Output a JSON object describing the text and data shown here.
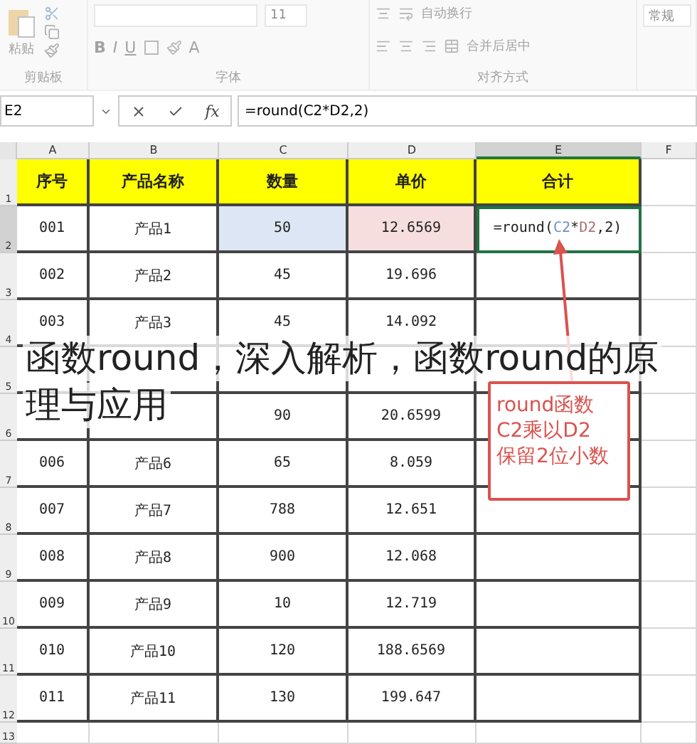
{
  "ribbon": {
    "disabled": true,
    "groups": [
      {
        "kind": "clipboard",
        "label": "剪贴板",
        "paste": "粘贴"
      },
      {
        "kind": "font",
        "label": "字体",
        "size": "11",
        "bold": "B",
        "italic": "I",
        "underline": "U",
        "font_color": "A"
      },
      {
        "kind": "alignment",
        "label": "对齐方式",
        "wrap": "自动换行",
        "merge": "合并后居中"
      },
      {
        "kind": "number",
        "format": "常规"
      }
    ]
  },
  "formula_bar": {
    "name_box": "E2",
    "function": "fx",
    "formula": "=round(C2*D2,2)"
  },
  "columns": [
    {
      "label": "A",
      "selected": false
    },
    {
      "label": "B",
      "selected": false
    },
    {
      "label": "C",
      "selected": false
    },
    {
      "label": "D",
      "selected": false
    },
    {
      "label": "E",
      "selected": true
    },
    {
      "label": "F",
      "selected": false
    }
  ],
  "rows": [
    {
      "label": "1",
      "selected": false,
      "kind": "header",
      "cells": [
        {
          "text": "序号"
        },
        {
          "text": "产品名称"
        },
        {
          "text": "数量"
        },
        {
          "text": "单价"
        },
        {
          "text": "合计"
        }
      ]
    },
    {
      "label": "2",
      "selected": true,
      "kind": "data",
      "cells": [
        {
          "text": "001"
        },
        {
          "text": "产品1"
        },
        {
          "text": "50",
          "color": "#dce6f4"
        },
        {
          "text": "12.6569",
          "color": "#f7dede"
        },
        {
          "active": true,
          "parts": [
            {
              "text": "=round("
            },
            {
              "text": "C2",
              "color": "#6f8fc8"
            },
            {
              "text": "*"
            },
            {
              "text": "D2",
              "color": "#b07070"
            },
            {
              "text": ",2)"
            }
          ]
        }
      ]
    },
    {
      "label": "3",
      "selected": false,
      "kind": "data",
      "cells": [
        {
          "text": "002"
        },
        {
          "text": "产品2"
        },
        {
          "text": "45"
        },
        {
          "text": "19.696"
        },
        {}
      ]
    },
    {
      "label": "4",
      "selected": false,
      "kind": "data",
      "cells": [
        {
          "text": "003"
        },
        {
          "text": "产品3"
        },
        {
          "text": "45"
        },
        {
          "text": "14.092"
        },
        {}
      ]
    },
    {
      "label": "5",
      "selected": false,
      "kind": "data",
      "cells": [
        {},
        {},
        {},
        {},
        {}
      ]
    },
    {
      "label": "6",
      "selected": false,
      "kind": "data",
      "cells": [
        {},
        {},
        {
          "text": "90"
        },
        {
          "text": "20.6599"
        },
        {}
      ]
    },
    {
      "label": "7",
      "selected": false,
      "kind": "data",
      "cells": [
        {
          "text": "006"
        },
        {
          "text": "产品6"
        },
        {
          "text": "65"
        },
        {
          "text": "8.059"
        },
        {}
      ]
    },
    {
      "label": "8",
      "selected": false,
      "kind": "data",
      "cells": [
        {
          "text": "007"
        },
        {
          "text": "产品7"
        },
        {
          "text": "788"
        },
        {
          "text": "12.651"
        },
        {}
      ]
    },
    {
      "label": "9",
      "selected": false,
      "kind": "data",
      "cells": [
        {
          "text": "008"
        },
        {
          "text": "产品8"
        },
        {
          "text": "900"
        },
        {
          "text": "12.068"
        },
        {}
      ]
    },
    {
      "label": "10",
      "selected": false,
      "kind": "data",
      "cells": [
        {
          "text": "009"
        },
        {
          "text": "产品9"
        },
        {
          "text": "10"
        },
        {
          "text": "12.719"
        },
        {}
      ]
    },
    {
      "label": "11",
      "selected": false,
      "kind": "data",
      "cells": [
        {
          "text": "010"
        },
        {
          "text": "产品10"
        },
        {
          "text": "120"
        },
        {
          "text": "188.6569"
        },
        {}
      ]
    },
    {
      "label": "12",
      "selected": false,
      "kind": "data",
      "cells": [
        {
          "text": "011"
        },
        {
          "text": "产品11"
        },
        {
          "text": "130"
        },
        {
          "text": "199.647"
        },
        {}
      ]
    },
    {
      "label": "13",
      "selected": false,
      "kind": "blank",
      "cells": [
        {},
        {},
        {},
        {},
        {}
      ]
    }
  ],
  "callout": {
    "lines": [
      "round函数",
      "C2乘以D2",
      "保留2位小数"
    ]
  },
  "caption": [
    "函数round，深入解析，函数round的原",
    "理与应用"
  ]
}
